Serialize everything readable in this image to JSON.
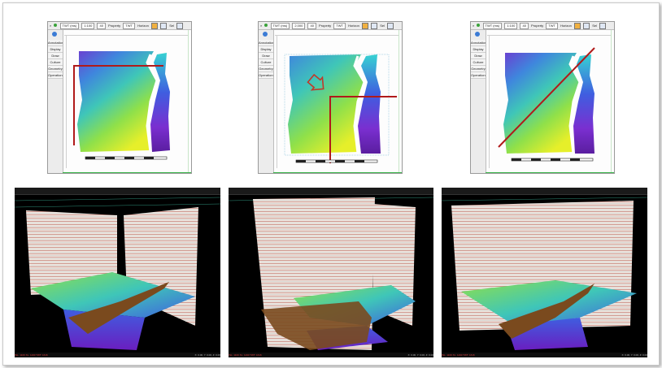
{
  "map_window": {
    "toolbar": {
      "domain_label": "TWT (ms)",
      "property_label": "Property",
      "property_value": "TWT",
      "horizon_label": "Horizon",
      "sel_label": "Sel"
    },
    "panels": [
      {
        "scale": "1:100",
        "step": "40"
      },
      {
        "scale": "2,000",
        "step": "40"
      },
      {
        "scale": "1:100",
        "step": "40"
      }
    ],
    "sidebar_items": [
      "Annotation",
      "Display",
      "Draw",
      "Culture",
      "Geometry",
      "Operations"
    ]
  },
  "colors": {
    "section_line": "#b01a1a",
    "arrow": "#c0392b",
    "surface_brown": "#7a4a1e",
    "seismic_red": "#8a1a10",
    "view_bg": "#000000",
    "grid_green": "#2f8f7a"
  },
  "icons": [
    "home-icon",
    "search-icon",
    "pan-icon",
    "zoom-icon",
    "arrow-icon"
  ],
  "views_3d": [
    {
      "left": "INL: 1100   XL: 1190   TWT: 1616",
      "right": "X: 0.00, Y: 0.00, Z: 0.00"
    },
    {
      "left": "INL: 1100   XL: 1190   TWT: 1616",
      "right": "X: 0.00, Y: 0.00, Z: 0.00"
    },
    {
      "left": "INL: 1100   XL: 1190   TWT: 1616",
      "right": "X: 0.00, Y: 0.00, Z: 0.00"
    }
  ]
}
